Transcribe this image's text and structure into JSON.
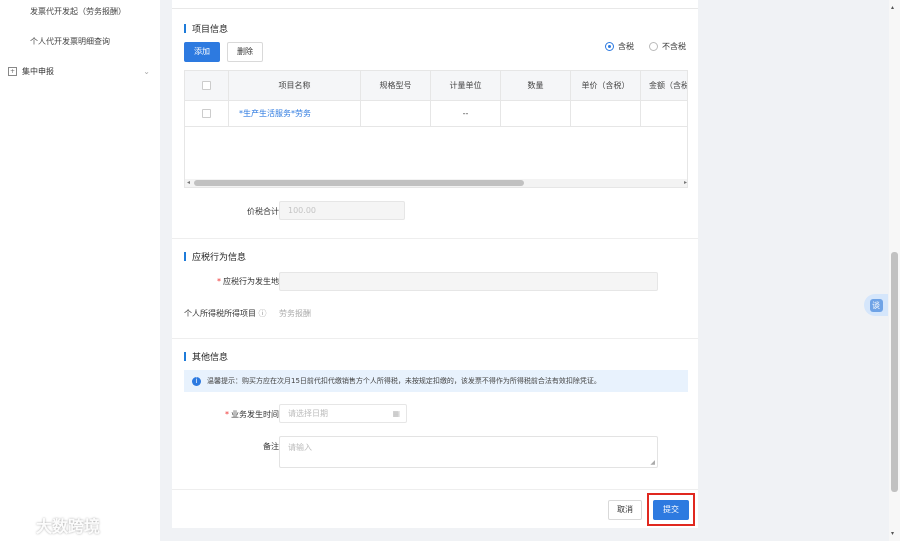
{
  "sidebar": {
    "items": [
      {
        "label": "发票代开发起（劳务报酬）"
      },
      {
        "label": "个人代开发票明细查询"
      }
    ],
    "group": {
      "label": "集中申报",
      "icon": "expand-box-icon",
      "chevron_icon": "chevron-down-icon"
    }
  },
  "project_section": {
    "title": "项目信息",
    "add_label": "添加",
    "delete_label": "删除",
    "tax_options": [
      {
        "label": "含税",
        "selected": true
      },
      {
        "label": "不含税",
        "selected": false
      }
    ],
    "table": {
      "headers": [
        "项目名称",
        "规格型号",
        "计量单位",
        "数量",
        "单价（含税）",
        "金额（含税）"
      ],
      "rows": [
        {
          "name": "*生产生活服务*劳务",
          "spec": "",
          "unit": "--",
          "qty": "",
          "price": "",
          "amount": ""
        }
      ]
    },
    "total_label": "价税合计",
    "total_value": "100.00"
  },
  "taxable_section": {
    "title": "应税行为信息",
    "place_label": "应税行为发生地",
    "place_value": "",
    "income_label": "个人所得税所得项目",
    "income_value": "劳务报酬"
  },
  "other_section": {
    "title": "其他信息",
    "notice": "温馨提示：购买方应在次月15日前代扣代缴销售方个人所得税，未按规定扣缴的，该发票不得作为所得税前合法有效扣除凭证。",
    "date_label": "业务发生时间",
    "date_placeholder": "请选择日期",
    "remark_label": "备注",
    "remark_placeholder": "请输入"
  },
  "footer": {
    "cancel_label": "取消",
    "submit_label": "提交"
  },
  "float_button": {
    "label": "谈"
  },
  "watermark": {
    "text": "大数跨境"
  },
  "colors": {
    "primary": "#2d7ae0",
    "highlight_outline": "#e0281f",
    "section_bar": "#1e7bd9"
  }
}
